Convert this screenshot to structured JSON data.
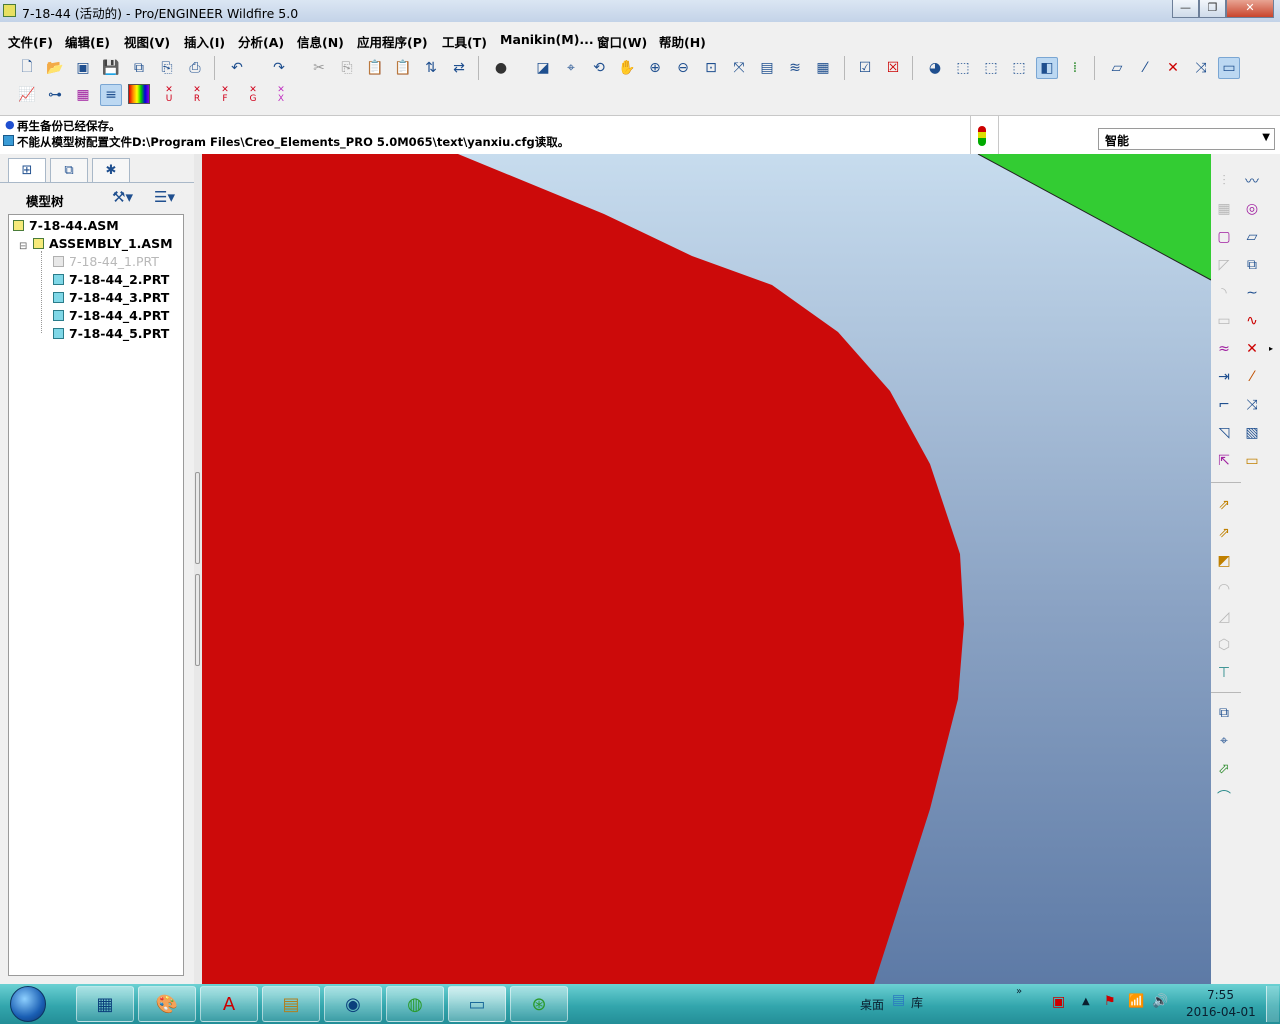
{
  "window": {
    "title": "7-18-44 (活动的) - Pro/ENGINEER Wildfire 5.0",
    "controls": [
      "—",
      "❐",
      "✕"
    ]
  },
  "menubar": [
    "文件(F)",
    "编辑(E)",
    "视图(V)",
    "插入(I)",
    "分析(A)",
    "信息(N)",
    "应用程序(P)",
    "工具(T)",
    "Manikin(M)...",
    "窗口(W)",
    "帮助(H)"
  ],
  "toolbar": {
    "row1_icons": [
      "new-icon",
      "open-icon",
      "open-asm-icon",
      "save-icon",
      "save-as-icon",
      "backup-icon",
      "print-icon",
      "undo-icon",
      "redo-icon",
      "cut-icon",
      "copy-icon",
      "paste-icon",
      "paste-special-icon",
      "regenerate-icon",
      "regen-manager-icon",
      "render-icon",
      "repaint-icon",
      "spin-center-icon",
      "orient-icon",
      "pan-icon",
      "zoom-in-icon",
      "zoom-out-icon",
      "refit-icon",
      "reorient-icon",
      "saved-views-icon",
      "layers-icon",
      "view-manager-icon",
      "window-activate-icon",
      "window-close-icon",
      "appearance-icon",
      "wireframe-icon",
      "hidden-line-icon",
      "no-hidden-icon",
      "shading-icon",
      "datum-icon",
      "datum-plane-icon",
      "datum-axis-icon",
      "datum-point-icon",
      "csys-icon",
      "annotation-icon"
    ],
    "row2_icons": [
      "analysis-icon",
      "measure-icon",
      "surface-analysis-icon",
      "curvature-icon",
      "color-scale-icon"
    ],
    "row2_markers": [
      "U",
      "R",
      "F",
      "G",
      "X"
    ]
  },
  "messages": {
    "line1": "再生备份已经保存。",
    "line2": "不能从模型树配置文件D:\\Program Files\\Creo_Elements_PRO 5.0M065\\text\\yanxiu.cfg读取。"
  },
  "filter": {
    "value": "智能"
  },
  "model_tree": {
    "label": "模型树",
    "items": [
      {
        "label": "7-18-44.ASM",
        "type": "asm",
        "level": 0,
        "suppressed": false
      },
      {
        "label": "ASSEMBLY_1.ASM",
        "type": "asm",
        "level": 1,
        "suppressed": false
      },
      {
        "label": "7-18-44_1.PRT",
        "type": "prt",
        "level": 2,
        "suppressed": true
      },
      {
        "label": "7-18-44_2.PRT",
        "type": "prt",
        "level": 2,
        "suppressed": false
      },
      {
        "label": "7-18-44_3.PRT",
        "type": "prt",
        "level": 2,
        "suppressed": false
      },
      {
        "label": "7-18-44_4.PRT",
        "type": "prt",
        "level": 2,
        "suppressed": false
      },
      {
        "label": "7-18-44_5.PRT",
        "type": "prt",
        "level": 2,
        "suppressed": false
      }
    ]
  },
  "graphics": {
    "part_colors": {
      "red_part": "#cc0a0a",
      "green_part": "#33cc33"
    },
    "background": [
      "#c7dcee",
      "#5d7aa6"
    ]
  },
  "taskbar": {
    "apps": [
      "calculator-icon",
      "paint-icon",
      "pdf-icon",
      "explorer-icon",
      "browser-icon",
      "wechat-icon",
      "proe-icon",
      "app-icon"
    ],
    "tray": {
      "desktop_label": "桌面",
      "library_label": "库",
      "time": "7:55",
      "date": "2016-04-01"
    }
  }
}
